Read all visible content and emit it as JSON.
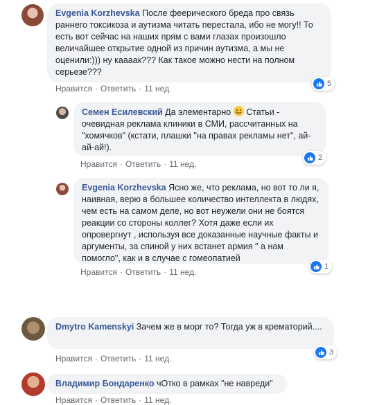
{
  "actions": {
    "like": "Нравится",
    "reply": "Ответить",
    "sep": "·"
  },
  "comments": [
    {
      "author": "Evgenia Korzhevska",
      "text": "После феерического бреда про связь раннего токсикоза и аутизма читать перестала, ибо не могу!! То есть вот сейчас на наших прям с вами глазах произошло величайшее открытие одной из причин аутизма, а мы не оценили:))) ну кааaак??? Как такое можно нести на полном серьезе???",
      "time": "11 нед.",
      "likes": "5"
    },
    {
      "author": "Семен Есилевский",
      "text_before": "Да элементарно",
      "text_after": "Статьи - очевидная реклама клиники в СМИ, рассчитанных на \"хомячков\" (кстати, плашки \"на правах рекламы нет\", ай-ай-ай!).",
      "time": "11 нед.",
      "likes": "2"
    },
    {
      "author": "Evgenia Korzhevska",
      "text": "Ясно же, что реклама, но вот то ли я, наивная, верю в большее количество интеллекта в людях, чем есть на самом деле, но вот неужели они не боятся реакции со стороны коллег? Хотя даже если их опровергнут , используя все доказанные научные факты и аргументы, за спиной у них встанет армия \" а нам помогло\", как и в случае с гомеопатией",
      "time": "11 нед.",
      "likes": "1"
    },
    {
      "author": "Dmytro Kamenskyi",
      "text": "Зачем же в морг то? Тогда уж в крематорий....",
      "time": "11 нед.",
      "likes": "3"
    },
    {
      "author": "Владимир Бондаренко",
      "text": "чОтко в рамках \"не навреди\"",
      "time": "11 нед."
    }
  ],
  "colors": {
    "like_blue": "#1877f2",
    "author": "#385898",
    "bubble": "#f2f3f5"
  }
}
